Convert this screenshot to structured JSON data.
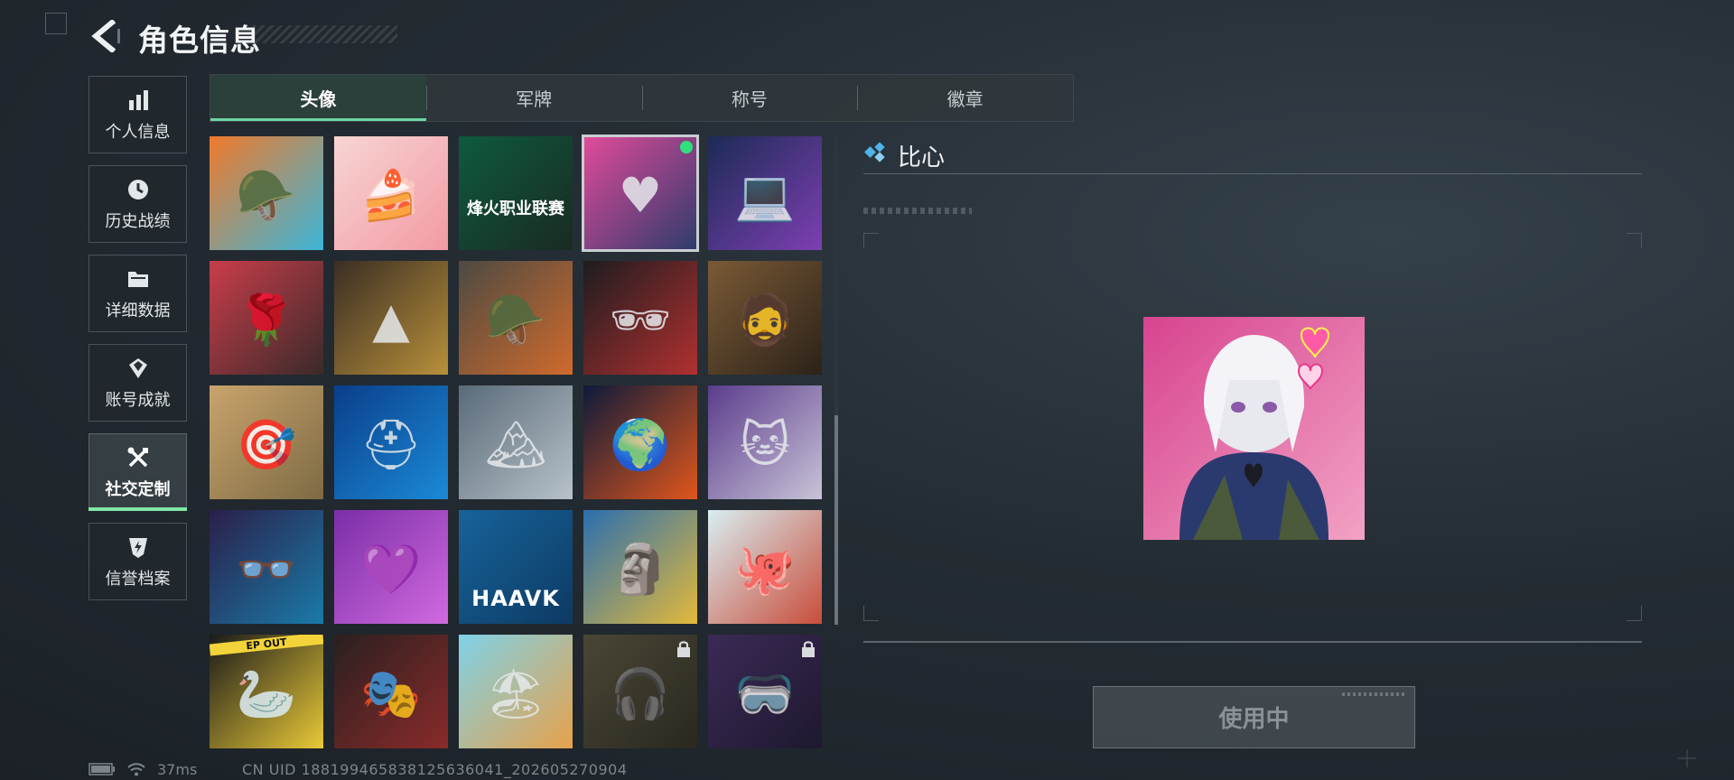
{
  "header": {
    "title": "角色信息"
  },
  "sidebar": {
    "items": [
      {
        "label": "个人信息",
        "icon": "bar-chart-icon"
      },
      {
        "label": "历史战绩",
        "icon": "history-clock-icon"
      },
      {
        "label": "详细数据",
        "icon": "folder-icon"
      },
      {
        "label": "账号成就",
        "icon": "achievement-badge-icon"
      },
      {
        "label": "社交定制",
        "icon": "wrench-tools-icon",
        "active": true
      },
      {
        "label": "信誉档案",
        "icon": "shield-lightning-icon"
      }
    ]
  },
  "tabs": [
    {
      "label": "头像",
      "active": true
    },
    {
      "label": "军牌"
    },
    {
      "label": "称号"
    },
    {
      "label": "徽章"
    }
  ],
  "grid": {
    "items": [
      {
        "name": "cartoon-soldier-avatar",
        "bg": [
          "#f07a2b",
          "#3bb6d9"
        ],
        "glyph": "🪖"
      },
      {
        "name": "strawberry-cake-avatar",
        "bg": [
          "#f7d5d3",
          "#f29aa4"
        ],
        "glyph": "🍰"
      },
      {
        "name": "league-logo-avatar",
        "bg": [
          "#0e5a3e",
          "#1a2a22"
        ],
        "glyph": "",
        "text": "烽火职业联赛"
      },
      {
        "name": "anime-girl-heart-avatar",
        "bg": [
          "#e14b9a",
          "#2e3b6c"
        ],
        "glyph": "♥",
        "selected": true
      },
      {
        "name": "operator-laptop-avatar",
        "bg": [
          "#1c2b55",
          "#7d3fb2"
        ],
        "glyph": "💻"
      },
      {
        "name": "rose-skull-avatar",
        "bg": [
          "#c93d4a",
          "#3a2a2a"
        ],
        "glyph": "🌹"
      },
      {
        "name": "triangle-emblem-avatar",
        "bg": [
          "#3a2e24",
          "#b8903a"
        ],
        "glyph": "▲"
      },
      {
        "name": "helmet-soldier-avatar",
        "bg": [
          "#4c4a42",
          "#d06a2c"
        ],
        "glyph": "🪖"
      },
      {
        "name": "suited-man-avatar",
        "bg": [
          "#1d1c1f",
          "#b13030"
        ],
        "glyph": "🕶"
      },
      {
        "name": "bearded-man-avatar",
        "bg": [
          "#7a5a36",
          "#2c2219"
        ],
        "glyph": "🧔"
      },
      {
        "name": "desert-soldier-avatar",
        "bg": [
          "#c9a46c",
          "#7d6a44"
        ],
        "glyph": "🎯"
      },
      {
        "name": "blue-knight-helmet-avatar",
        "bg": [
          "#0a3e8a",
          "#1b8ad7"
        ],
        "glyph": "⛑"
      },
      {
        "name": "mountain-chair-avatar",
        "bg": [
          "#5a6a78",
          "#b7c2ca"
        ],
        "glyph": "🏔"
      },
      {
        "name": "burning-planet-avatar",
        "bg": [
          "#0d1a3a",
          "#e0561c"
        ],
        "glyph": "🌍"
      },
      {
        "name": "white-cat-avatar",
        "bg": [
          "#5b3c8c",
          "#c8c3d7"
        ],
        "glyph": "🐱"
      },
      {
        "name": "glasses-man-avatar",
        "bg": [
          "#2b1f4a",
          "#1a7aa8"
        ],
        "glyph": "👓"
      },
      {
        "name": "purple-girl-avatar",
        "bg": [
          "#7a2ea8",
          "#d06adf"
        ],
        "glyph": "💜"
      },
      {
        "name": "haavk-logo-avatar",
        "bg": [
          "#17639a",
          "#0d3a63"
        ],
        "glyph": "",
        "text": "HAAVK"
      },
      {
        "name": "tiki-robot-avatar",
        "bg": [
          "#2a6eb0",
          "#e3b93a"
        ],
        "glyph": "🗿"
      },
      {
        "name": "octopus-wave-avatar",
        "bg": [
          "#d8eef2",
          "#c94d3a"
        ],
        "glyph": "🐙"
      },
      {
        "name": "goose-avatar",
        "bg": [
          "#1a1a1a",
          "#e9c938"
        ],
        "glyph": "🦢",
        "text": "EP OUT"
      },
      {
        "name": "jigsaw-mask-avatar",
        "bg": [
          "#2a2020",
          "#8a2a2a"
        ],
        "glyph": "🎭"
      },
      {
        "name": "summer-girl-avatar",
        "bg": [
          "#7fd2e8",
          "#e7a14a"
        ],
        "glyph": "🏖"
      },
      {
        "name": "bald-operator-avatar",
        "bg": [
          "#4a4636",
          "#2a281f"
        ],
        "glyph": "🎧",
        "locked": true
      },
      {
        "name": "goggles-woman-avatar",
        "bg": [
          "#3b2a55",
          "#1e1830"
        ],
        "glyph": "🥽",
        "locked": true
      }
    ]
  },
  "detail": {
    "name": "比心",
    "use_button": "使用中"
  },
  "status": {
    "ping": "37ms",
    "uid": "CN UID 1881994658381256360​41_202605270904"
  },
  "colors": {
    "accent": "#6fd6a4",
    "selected_dot": "#2fe07c"
  }
}
